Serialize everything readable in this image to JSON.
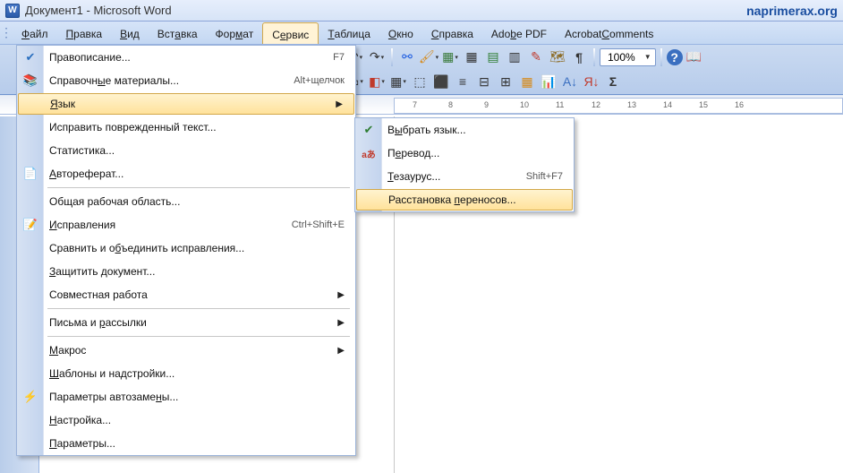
{
  "title": "Документ1 - Microsoft Word",
  "brand": "naprimerax.org",
  "menubar": {
    "file": {
      "pre": "",
      "u": "Ф",
      "post": "айл"
    },
    "edit": {
      "pre": "",
      "u": "П",
      "post": "равка"
    },
    "view": {
      "pre": "",
      "u": "В",
      "post": "ид"
    },
    "insert": {
      "pre": "Вст",
      "u": "а",
      "post": "вка"
    },
    "format": {
      "pre": "Фор",
      "u": "м",
      "post": "ат"
    },
    "service": {
      "pre": "С",
      "u": "е",
      "post": "рвис"
    },
    "table": {
      "pre": "",
      "u": "Т",
      "post": "аблица"
    },
    "window": {
      "pre": "",
      "u": "О",
      "post": "кно"
    },
    "help": {
      "pre": "",
      "u": "С",
      "post": "правка"
    },
    "adobe": {
      "pre": "Ado",
      "u": "b",
      "post": "e PDF"
    },
    "acrobat": {
      "pre": "Acrobat ",
      "u": "C",
      "post": "omments"
    }
  },
  "zoom": "100%",
  "ruler": {
    "n7": "7",
    "n8": "8",
    "n9": "9",
    "n10": "10",
    "n11": "11",
    "n12": "12",
    "n13": "13",
    "n14": "14",
    "n15": "15",
    "n16": "16"
  },
  "service_menu": {
    "spelling": {
      "label": "Правописание...",
      "shortcut": "F7"
    },
    "reference": {
      "pre": "Справочн",
      "u": "ы",
      "post": "е материалы...",
      "shortcut": "Alt+щелчок"
    },
    "language": {
      "pre": "",
      "u": "Я",
      "post": "зык"
    },
    "fixtext": {
      "label": "Исправить поврежденный текст..."
    },
    "stats": {
      "label": "Статистика..."
    },
    "autoref": {
      "pre": "",
      "u": "А",
      "post": "втореферат..."
    },
    "workspace": {
      "label": "Общая рабочая область..."
    },
    "track": {
      "pre": "",
      "u": "И",
      "post": "справления",
      "shortcut": "Ctrl+Shift+E"
    },
    "compare": {
      "pre": "Сравнить и о",
      "u": "б",
      "post": "ъединить исправления..."
    },
    "protect": {
      "pre": "",
      "u": "З",
      "post": "ащитить документ..."
    },
    "collab": {
      "label": "Совместная работа"
    },
    "mail": {
      "pre": "Письма и ",
      "u": "р",
      "post": "ассылки"
    },
    "macro": {
      "pre": "",
      "u": "М",
      "post": "акрос"
    },
    "templates": {
      "pre": "",
      "u": "Ш",
      "post": "аблоны и надстройки..."
    },
    "autocorr": {
      "pre": "Параметры автозаме",
      "u": "н",
      "post": "ы..."
    },
    "custom": {
      "pre": "",
      "u": "Н",
      "post": "астройка..."
    },
    "options": {
      "pre": "",
      "u": "П",
      "post": "араметры..."
    }
  },
  "language_menu": {
    "choose": {
      "pre": "В",
      "u": "ы",
      "post": "брать язык..."
    },
    "translate": {
      "pre": "П",
      "u": "е",
      "post": "ревод..."
    },
    "thesaurus": {
      "pre": "",
      "u": "Т",
      "post": "езаурус...",
      "shortcut": "Shift+F7"
    },
    "hyphen": {
      "pre": "Расстановка ",
      "u": "п",
      "post": "ереносов..."
    }
  }
}
